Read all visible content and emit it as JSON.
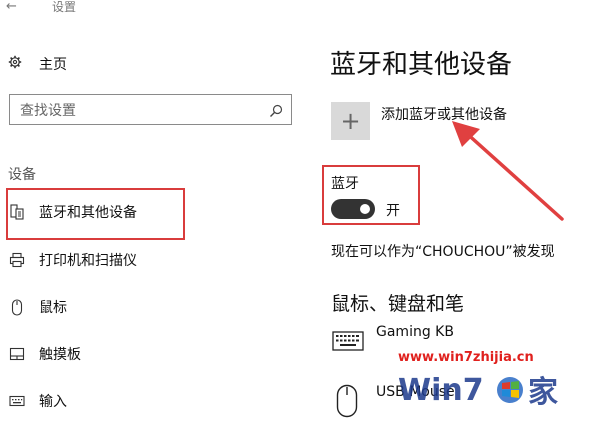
{
  "window": {
    "title": "设置",
    "back_glyph": "←"
  },
  "sidebar": {
    "home_label": "主页",
    "search_placeholder": "查找设置",
    "section_label": "设备",
    "items": [
      {
        "label": "蓝牙和其他设备",
        "icon": "bluetooth-devices-icon",
        "selected": true
      },
      {
        "label": "打印机和扫描仪",
        "icon": "printer-icon"
      },
      {
        "label": "鼠标",
        "icon": "mouse-icon"
      },
      {
        "label": "触摸板",
        "icon": "touchpad-icon"
      },
      {
        "label": "输入",
        "icon": "keyboard-icon"
      }
    ]
  },
  "main": {
    "title": "蓝牙和其他设备",
    "add_device_label": "添加蓝牙或其他设备",
    "bluetooth_label": "蓝牙",
    "bluetooth_state": "开",
    "bluetooth_on": true,
    "discoverable_text": "现在可以作为“CHOUCHOU”被发现",
    "section_title": "鼠标、键盘和笔",
    "devices": [
      {
        "name": "Gaming KB",
        "icon": "keyboard-icon"
      },
      {
        "name": "USB Mouse",
        "icon": "mouse-icon"
      }
    ]
  },
  "annotations": {
    "highlight_color": "#d93c3c"
  },
  "watermark": {
    "url": "www.win7zhijia.cn",
    "logo_text": "Win7家"
  }
}
